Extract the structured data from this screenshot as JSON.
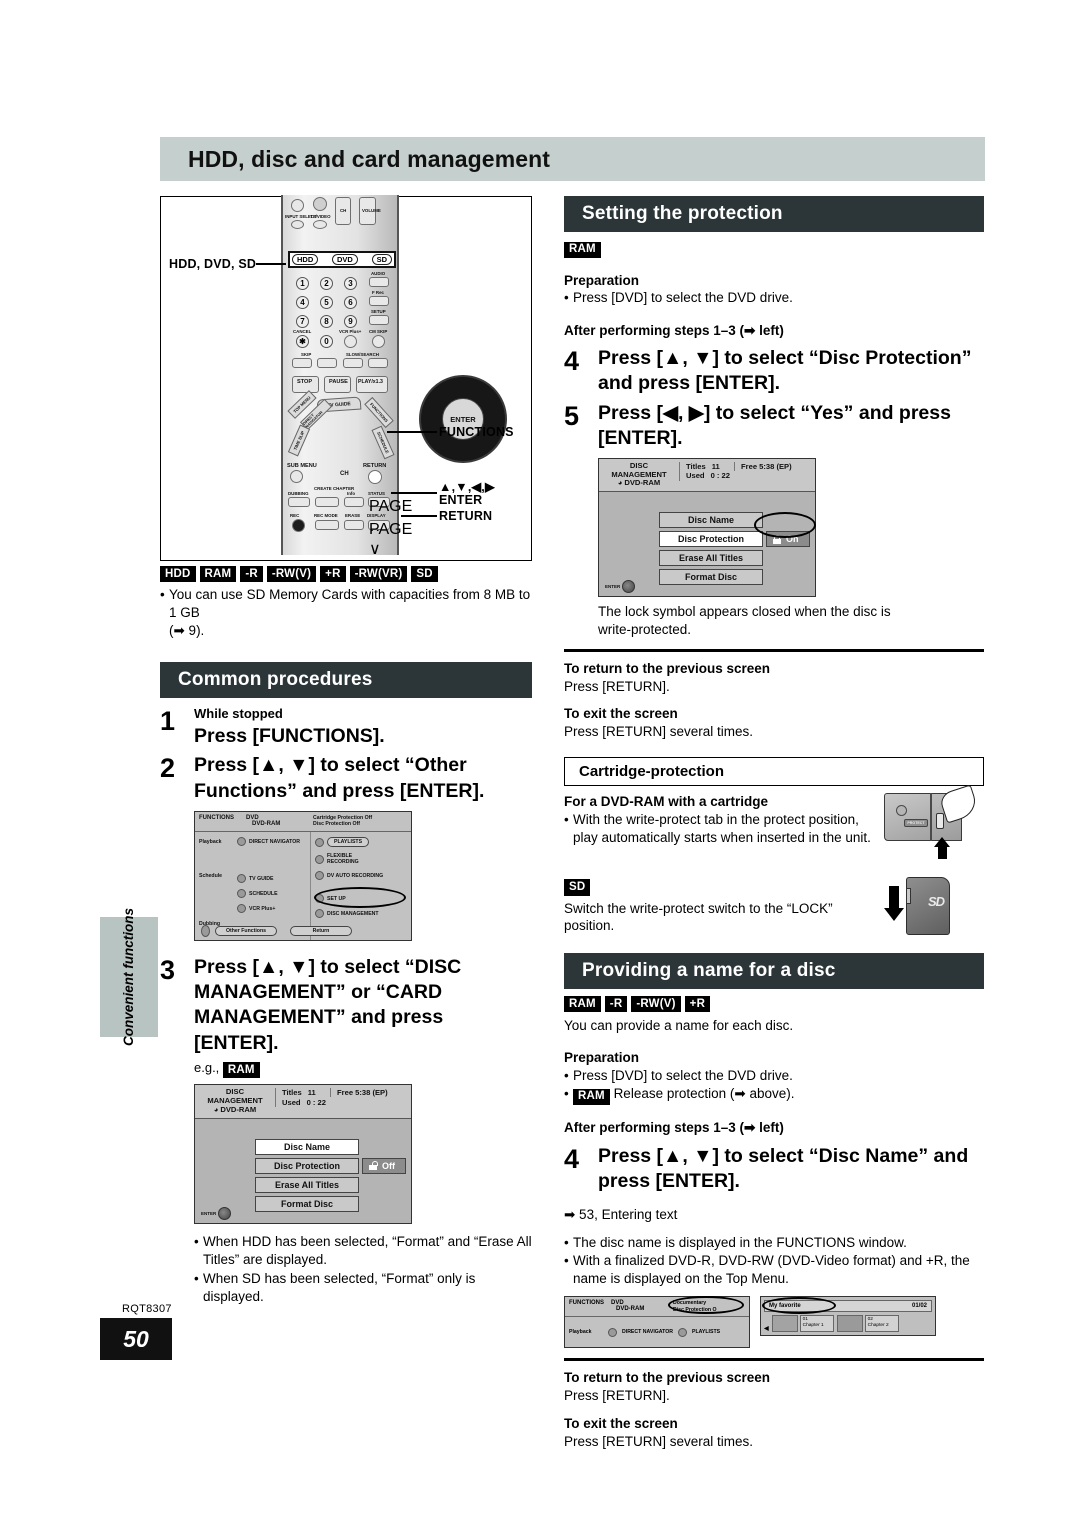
{
  "page": {
    "title": "HDD, disc and card management",
    "manual_code": "RQT8307",
    "page_number": "50",
    "side_tab": "Convenient functions"
  },
  "remote": {
    "callouts": {
      "source": "HDD, DVD, SD",
      "functions": "FUNCTIONS",
      "cursor": "▲,▼,◀,▶",
      "enter": "ENTER",
      "return": "RETURN"
    },
    "source_buttons": [
      "HDD",
      "DVD",
      "SD"
    ],
    "top_labels": [
      "INPUT SELECT",
      "TV/VIDEO",
      "CH",
      "VOLUME"
    ],
    "numeric_keys": [
      "1",
      "2",
      "3",
      "4",
      "5",
      "6",
      "7",
      "8",
      "9",
      "0"
    ],
    "side_labels": [
      "AUDIO",
      "F Rec",
      "SETUP",
      "CM SKIP"
    ],
    "cancel_label": "CANCEL",
    "vcrplus_label": "VCR Plus+",
    "skip_label": "SKIP",
    "slow_label": "SLOW/SEARCH",
    "transport": [
      "STOP",
      "PAUSE",
      "PLAY/x1.3"
    ],
    "dpad": {
      "top_menu": "TOP MENU",
      "direct_navigator": "DIRECT NAVIGATOR",
      "time_slip": "TIME SLIP",
      "tv_guide": "TV GUIDE",
      "functions": "FUNCTIONS",
      "schedule": "SCHEDULE",
      "enter": "ENTER",
      "ch": "CH"
    },
    "bottom_labels": [
      "SUB MENU",
      "RETURN",
      "DUBBING",
      "CREATE CHAPTER",
      "Info",
      "STATUS",
      "REC",
      "REC MODE",
      "ERASE",
      "DISPLAY",
      "PAGE ∧",
      "PAGE ∨"
    ]
  },
  "media_badges_all": [
    "HDD",
    "RAM",
    "-R",
    "-RW(V)",
    "+R",
    "-RW(VR)",
    "SD"
  ],
  "sd_note": {
    "line1": "You can use SD Memory Cards with capacities from 8 MB to 1 GB",
    "line2": "(➡ 9)."
  },
  "common_procedures": {
    "heading": "Common procedures",
    "steps": [
      {
        "num": "1",
        "small": "While stopped",
        "big": "Press [FUNCTIONS]."
      },
      {
        "num": "2",
        "small": "",
        "big": "Press [▲, ▼] to select “Other Functions” and press [ENTER]."
      },
      {
        "num": "3",
        "small": "",
        "big": "Press [▲, ▼] to select “DISC MANAGEMENT” or “CARD MANAGEMENT” and press [ENTER]."
      }
    ],
    "eg_label": "e.g.,",
    "eg_badge": "RAM",
    "notes": [
      "When HDD has been selected, “Format” and “Erase All Titles” are displayed.",
      "When SD has been selected, “Format” only is displayed."
    ]
  },
  "functions_osd": {
    "title": "FUNCTIONS",
    "drive": "DVD",
    "disc": "DVD-RAM",
    "status_line1": "Cartridge Protection Off",
    "status_line2": "Disc Protection Off",
    "rows": [
      {
        "group": "Playback",
        "left": "DIRECT NAVIGATOR",
        "right": [
          "PLAYLISTS",
          "FLEXIBLE RECORDING",
          "DV AUTO RECORDING"
        ]
      },
      {
        "group": "Schedule",
        "left": "TV GUIDE",
        "right": [
          "SET UP",
          "DISC MANAGEMENT"
        ]
      },
      {
        "group": "",
        "left": "SCHEDULE",
        "right": []
      },
      {
        "group": "",
        "left": "VCR Plus+",
        "right": []
      },
      {
        "group": "Dubbing",
        "left": "DUBBING",
        "right": []
      }
    ],
    "buttons": [
      "Other Functions",
      "Return"
    ],
    "highlighted": "DISC MANAGEMENT"
  },
  "disc_management_osd": {
    "title_line1": "DISC",
    "title_line2": "MANAGEMENT",
    "disc_type": "DVD-RAM",
    "titles_label": "Titles",
    "titles_value": "11",
    "used_label": "Used",
    "used_value": "0 : 22",
    "free": "Free  5:38 (EP)",
    "items": [
      "Disc Name",
      "Disc Protection",
      "Erase All Titles",
      "Format Disc"
    ],
    "protection_off": "Off",
    "protection_on": "On",
    "enter_label": "ENTER"
  },
  "setting_protection": {
    "heading": "Setting the protection",
    "badge": "RAM",
    "preparation_label": "Preparation",
    "preparation_items": [
      "Press [DVD] to select the DVD drive."
    ],
    "after_steps": "After performing steps 1–3 (➡ left)",
    "steps": [
      {
        "num": "4",
        "big": "Press [▲, ▼] to select “Disc Protection” and press [ENTER]."
      },
      {
        "num": "5",
        "big": "Press [◀, ▶] to select “Yes” and press [ENTER]."
      }
    ],
    "caption": "The lock symbol appears closed when the disc is write-protected.",
    "return_label": "To return to the previous screen",
    "return_text": "Press [RETURN].",
    "exit_label": "To exit the screen",
    "exit_text": "Press [RETURN] several times."
  },
  "cartridge_protection": {
    "heading": "Cartridge-protection",
    "dvdram_label": "For a DVD-RAM with a cartridge",
    "dvdram_text": "With the write-protect tab in the protect position, play automatically starts when inserted in the unit.",
    "sd_badge": "SD",
    "sd_text": "Switch the write-protect switch to the “LOCK” position.",
    "protect_tab_text": "PROTECT"
  },
  "providing_name": {
    "heading": "Providing a name for a disc",
    "badges": [
      "RAM",
      "-R",
      "-RW(V)",
      "+R"
    ],
    "intro": "You can provide a name for each disc.",
    "preparation_label": "Preparation",
    "preparation_items": [
      "Press [DVD] to select the DVD drive."
    ],
    "preparation_badge_item": {
      "badge": "RAM",
      "text": "Release protection (➡ above)."
    },
    "after_steps": "After performing steps 1–3 (➡ left)",
    "step": {
      "num": "4",
      "big": "Press [▲, ▼] to select “Disc Name” and press [ENTER]."
    },
    "ref": "➡ 53, Entering text",
    "notes": [
      "The disc name is displayed in the FUNCTIONS window.",
      "With a finalized DVD-R, DVD-RW (DVD-Video format) and +R, the name is displayed on the Top Menu."
    ],
    "return_label": "To return to the previous screen",
    "return_text": "Press [RETURN].",
    "exit_label": "To exit the screen",
    "exit_text": "Press [RETURN] several times.",
    "functions_preview": {
      "title": "FUNCTIONS",
      "drive": "DVD",
      "disc": "DVD-RAM",
      "disc_name": "Documentary",
      "status": "Disc Protection O",
      "row_group": "Playback",
      "left": "DIRECT NAVIGATOR",
      "right": "PLAYLISTS"
    },
    "top_menu_preview": {
      "name": "My favorite",
      "pages": "01/02",
      "chapters": [
        {
          "num": "01",
          "label": "Chapter 1"
        },
        {
          "num": "02",
          "label": "Chapter 2"
        }
      ]
    }
  },
  "colors": {
    "title_band": "#c5cfcd",
    "section_header": "#2c3639",
    "side_tab": "#b8c4c2",
    "badge": "#000000"
  }
}
